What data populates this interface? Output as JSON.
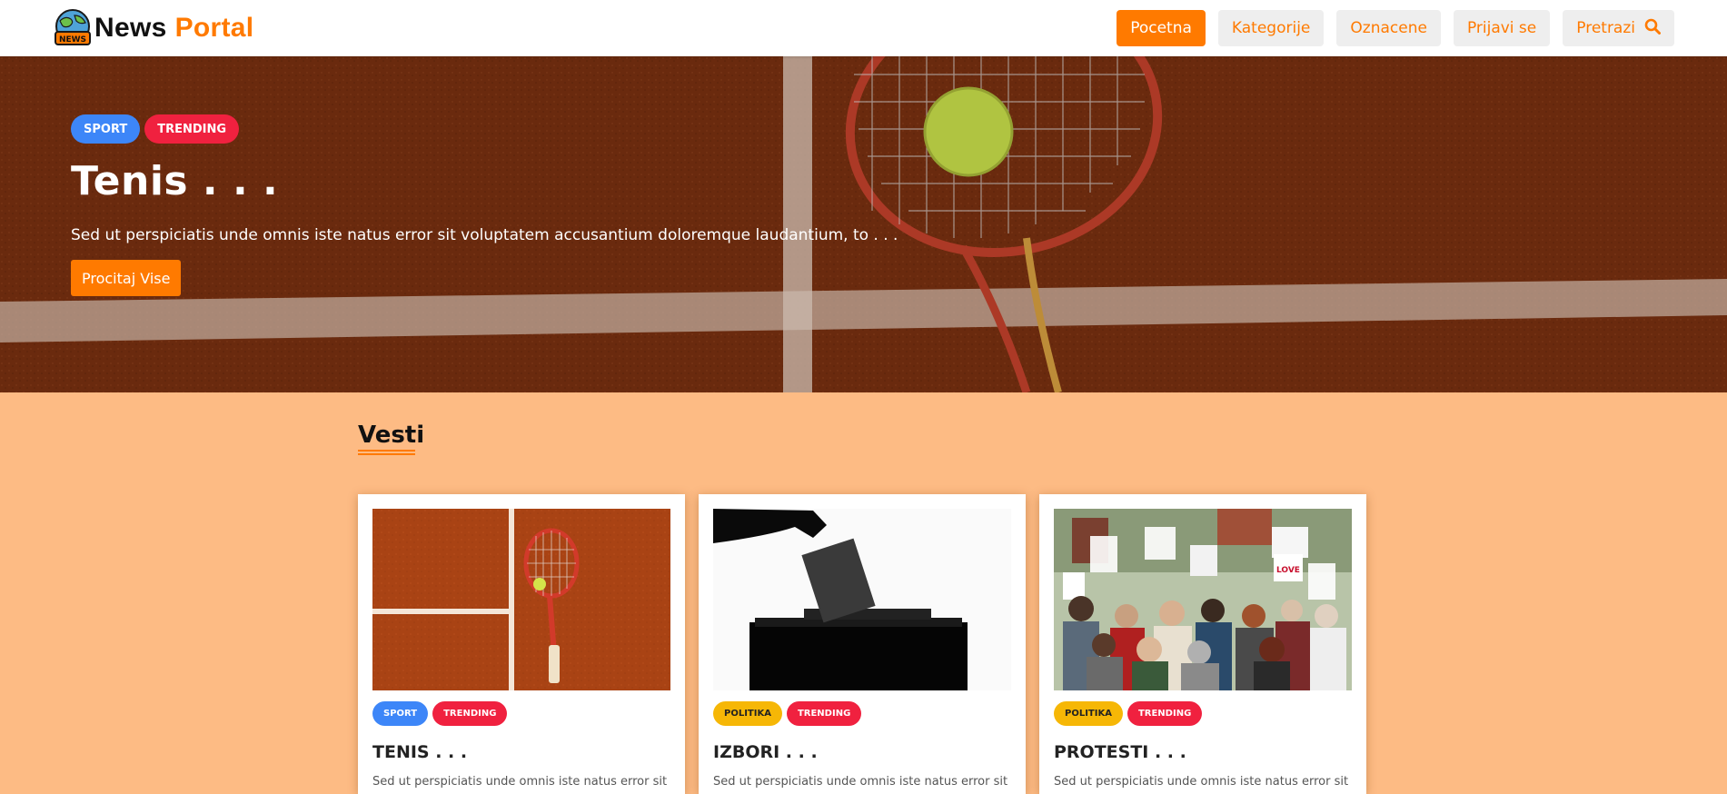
{
  "header": {
    "brand_part1": "News",
    "brand_part2": "Portal",
    "logo_text": "NEWS",
    "nav": [
      {
        "label": "Pocetna",
        "active": true
      },
      {
        "label": "Kategorije"
      },
      {
        "label": "Oznacene"
      },
      {
        "label": "Prijavi se"
      },
      {
        "label": "Pretrazi",
        "icon": "search-icon"
      }
    ]
  },
  "hero": {
    "badges": [
      "SPORT",
      "TRENDING"
    ],
    "title": "Tenis . . .",
    "description": "Sed ut perspiciatis unde omnis iste natus error sit voluptatem accusantium doloremque laudantium, to . . .",
    "button": "Procitaj Vise"
  },
  "section": {
    "title": "Vesti"
  },
  "cards": [
    {
      "badges": [
        "SPORT",
        "TRENDING"
      ],
      "title": "TENIS . . .",
      "text": "Sed ut perspiciatis unde omnis iste natus error sit",
      "image": "tennis-court-image"
    },
    {
      "badges": [
        "POLITIKA",
        "TRENDING"
      ],
      "title": "IZBORI . . .",
      "text": "Sed ut perspiciatis unde omnis iste natus error sit",
      "image": "ballot-box-image"
    },
    {
      "badges": [
        "POLITIKA",
        "TRENDING"
      ],
      "title": "PROTESTI . . .",
      "text": "Sed ut perspiciatis unde omnis iste natus error sit",
      "image": "protest-crowd-image"
    }
  ],
  "colors": {
    "accent": "#ff7a00",
    "page_bg": "#fdbb84",
    "sport_badge": "#3d86f8",
    "trending_badge": "#f0213f",
    "politika_badge": "#f6b706"
  }
}
